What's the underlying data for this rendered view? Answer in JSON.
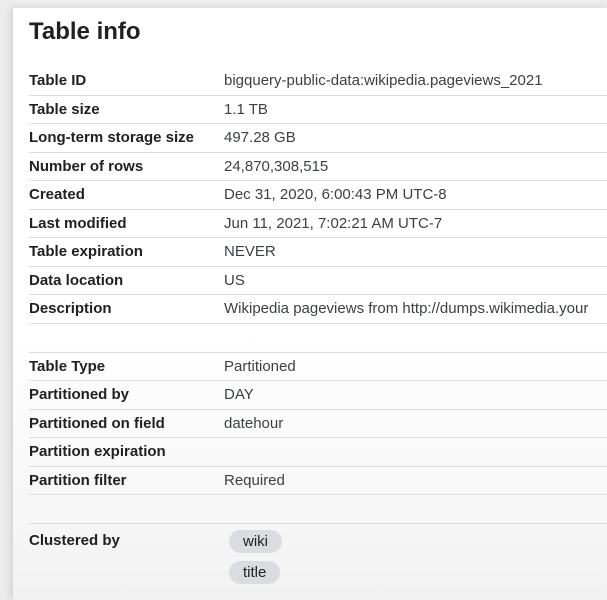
{
  "title": "Table info",
  "info_rows": [
    {
      "label": "Table ID",
      "value": "bigquery-public-data:wikipedia.pageviews_2021"
    },
    {
      "label": "Table size",
      "value": "1.1 TB"
    },
    {
      "label": "Long-term storage size",
      "value": "497.28 GB"
    },
    {
      "label": "Number of rows",
      "value": "24,870,308,515"
    },
    {
      "label": "Created",
      "value": "Dec 31, 2020, 6:00:43 PM UTC-8"
    },
    {
      "label": "Last modified",
      "value": "Jun 11, 2021, 7:02:21 AM UTC-7"
    },
    {
      "label": "Table expiration",
      "value": "NEVER"
    },
    {
      "label": "Data location",
      "value": "US"
    },
    {
      "label": "Description",
      "value": "Wikipedia pageviews from http://dumps.wikimedia.your"
    }
  ],
  "partition_rows": [
    {
      "label": "Table Type",
      "value": "Partitioned"
    },
    {
      "label": "Partitioned by",
      "value": "DAY"
    },
    {
      "label": "Partitioned on field",
      "value": "datehour"
    },
    {
      "label": "Partition expiration",
      "value": ""
    },
    {
      "label": "Partition filter",
      "value": "Required"
    }
  ],
  "clustering": {
    "label": "Clustered by",
    "fields": [
      "wiki",
      "title"
    ]
  }
}
